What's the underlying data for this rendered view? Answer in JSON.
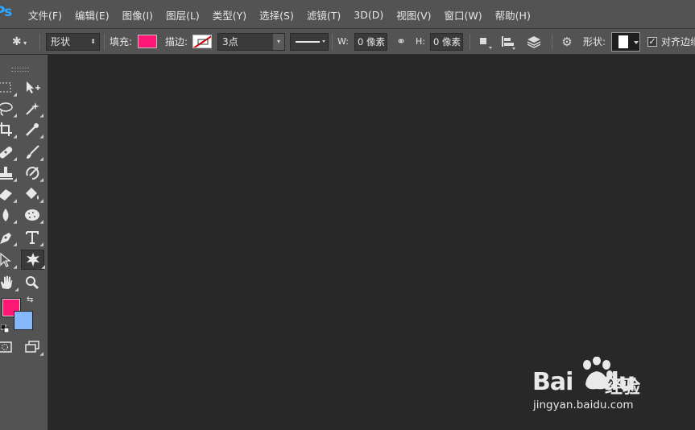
{
  "app": {
    "logo_text": "Ps"
  },
  "menu": {
    "items": [
      "文件(F)",
      "编辑(E)",
      "图像(I)",
      "图层(L)",
      "类型(Y)",
      "选择(S)",
      "滤镜(T)",
      "3D(D)",
      "视图(V)",
      "窗口(W)",
      "帮助(H)"
    ]
  },
  "options": {
    "mode_value": "形状",
    "fill_label": "填充:",
    "fill_color": "#ff1775",
    "stroke_label": "描边:",
    "stroke_width_value": "3点",
    "w_label": "W:",
    "w_value": "0 像素",
    "h_label": "H:",
    "h_value": "0 像素",
    "shape_label": "形状:",
    "align_edges_label": "对齐边缘",
    "align_edges_checked": true
  },
  "colors": {
    "foreground": "#ff1775",
    "background": "#85b7f9"
  },
  "watermark": {
    "brand": "Bai",
    "brand_suffix": "du",
    "product": "经验",
    "url": "jingyan.baidu.com"
  }
}
